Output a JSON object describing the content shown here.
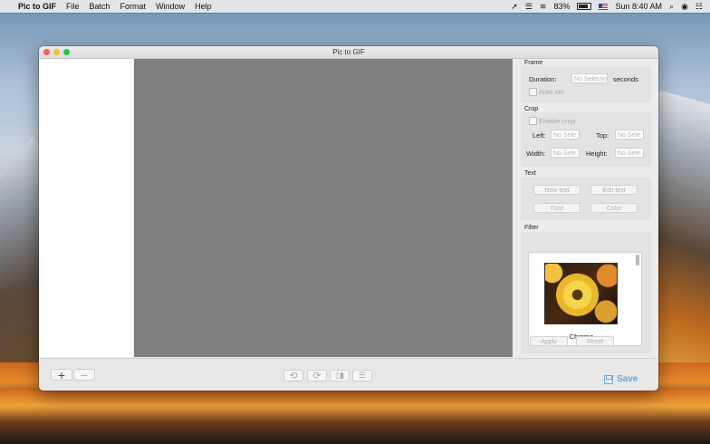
{
  "menubar": {
    "apple": "",
    "app_name": "Pic to GIF",
    "menus": [
      "File",
      "Batch",
      "Format",
      "Window",
      "Help"
    ],
    "battery": "83%",
    "clock": "Sun 8:40 AM"
  },
  "window": {
    "title": "Pic to GIF"
  },
  "frame": {
    "title": "Frame",
    "duration_label": "Duration:",
    "duration_value": "No Selection",
    "duration_unit": "seconds",
    "autoset_label": "Auto set"
  },
  "crop": {
    "title": "Crop",
    "enable_label": "Enable crop",
    "left_label": "Left:",
    "top_label": "Top:",
    "width_label": "Width:",
    "height_label": "Height:",
    "placeholder": "No Sele"
  },
  "text": {
    "title": "Text",
    "new_text": "New text",
    "edit_text": "Edit text",
    "font": "Font",
    "color": "Color"
  },
  "filter": {
    "title": "Filter",
    "selected_name": "Chrome",
    "apply": "Apply",
    "reset": "Reset"
  },
  "bottombar": {
    "add": "+",
    "remove": "−",
    "save_label": "Save"
  },
  "colors": {
    "accent": "#6aa9d8",
    "preview_bg": "#808080"
  }
}
